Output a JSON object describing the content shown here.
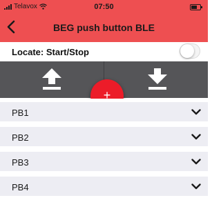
{
  "status_bar": {
    "carrier": "Telavox",
    "time": "07:50"
  },
  "nav": {
    "title": "BEG push button BLE"
  },
  "locate": {
    "label": "Locate: Start/Stop",
    "enabled": false
  },
  "controls": {
    "fab_label": "+"
  },
  "buttons": [
    {
      "label": "PB1"
    },
    {
      "label": "PB2"
    },
    {
      "label": "PB3"
    },
    {
      "label": "PB4"
    }
  ],
  "colors": {
    "accent": "#ee4f51",
    "fab": "#ec1c29",
    "bar": "#555558",
    "row": "#ededf3"
  }
}
